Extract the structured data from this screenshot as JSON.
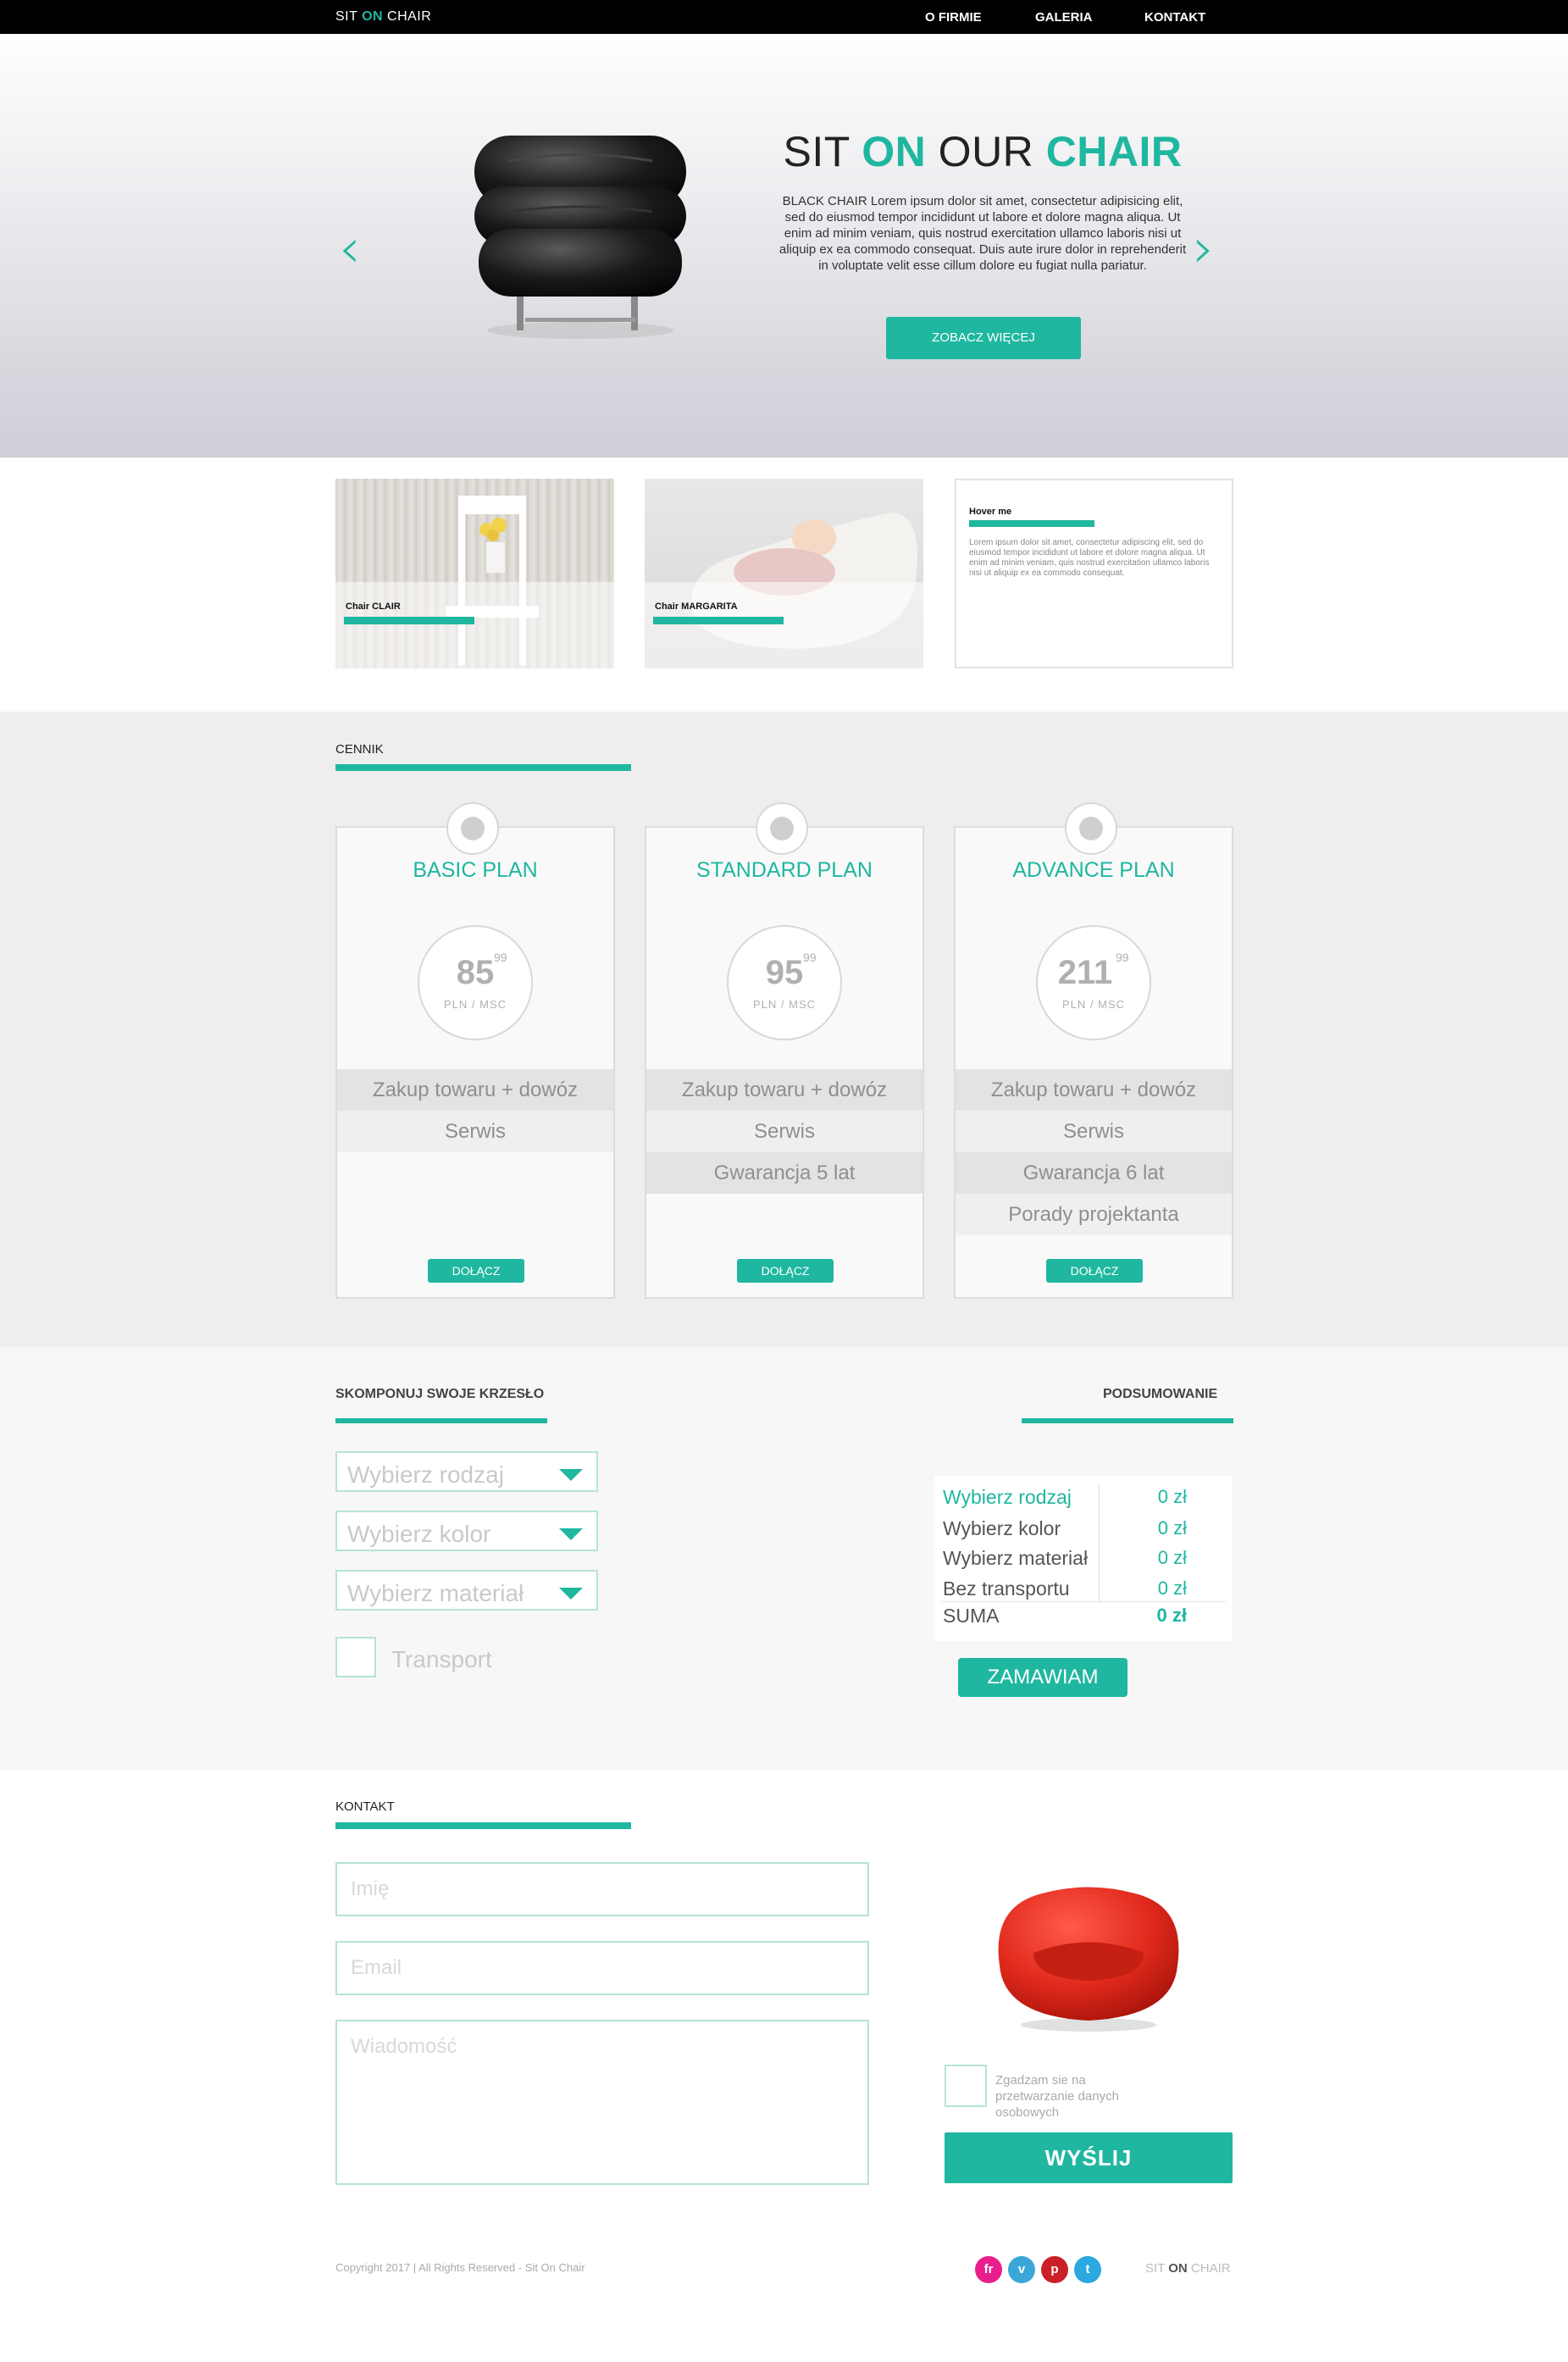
{
  "brand": {
    "prefix": "SIT",
    "highlight": "ON",
    "suffix": "CHAIR"
  },
  "nav": {
    "items": [
      "O FIRMIE",
      "GALERIA",
      "KONTAKT"
    ]
  },
  "hero": {
    "title_1": "SIT",
    "title_2": "ON",
    "title_3": "OUR",
    "title_4": "CHAIR",
    "text": "BLACK CHAIR Lorem ipsum dolor sit amet, consectetur adipisicing elit, sed do eiusmod tempor incididunt ut labore et dolore magna aliqua. Ut enim ad minim veniam, quis nostrud exercitation ullamco laboris nisi ut aliquip ex ea commodo consequat. Duis aute irure dolor in reprehenderit in voluptate velit esse cillum dolore eu fugiat nulla pariatur.",
    "button": "ZOBACZ WIĘCEJ",
    "prev_icon": "chevron-left-icon",
    "next_icon": "chevron-right-icon"
  },
  "gallery": {
    "cards": [
      {
        "label": "Chair CLAIR"
      },
      {
        "label": "Chair MARGARITA"
      }
    ],
    "hover_card": {
      "title": "Hover me",
      "text": "Lorem ipsum dolor sit amet, consectetur adipiscing elit, sed do eiusmod tempor incididunt ut labore et dolore magna aliqua. Ut enim ad minim veniam, quis nostrud exercitation ullamco laboris nisi ut aliquip ex ea commodo consequat."
    }
  },
  "pricing": {
    "title": "CENNIK",
    "plans": [
      {
        "name": "BASIC PLAN",
        "price": "85",
        "cents": "99",
        "unit": "PLN / MSC",
        "features": [
          "Zakup towaru + dowóz",
          "Serwis"
        ],
        "button": "DOŁĄCZ"
      },
      {
        "name": "STANDARD PLAN",
        "price": "95",
        "cents": "99",
        "unit": "PLN / MSC",
        "features": [
          "Zakup towaru + dowóz",
          "Serwis",
          "Gwarancja 5 lat"
        ],
        "button": "DOŁĄCZ"
      },
      {
        "name": "ADVANCE PLAN",
        "price": "211",
        "cents": "99",
        "unit": "PLN / MSC",
        "features": [
          "Zakup towaru + dowóz",
          "Serwis",
          "Gwarancja 6 lat",
          "Porady projektanta"
        ],
        "button": "DOŁĄCZ"
      }
    ]
  },
  "configurator": {
    "title": "SKOMPONUJ SWOJE KRZESŁO",
    "selects": [
      "Wybierz rodzaj",
      "Wybierz kolor",
      "Wybierz materiał"
    ],
    "transport_label": "Transport",
    "summary_title": "PODSUMOWANIE",
    "summary_rows": [
      {
        "label": "Wybierz rodzaj",
        "value": "0 zł"
      },
      {
        "label": "Wybierz kolor",
        "value": "0 zł"
      },
      {
        "label": "Wybierz materiał",
        "value": "0 zł"
      },
      {
        "label": "Bez transportu",
        "value": "0 zł"
      }
    ],
    "sum_label": "SUMA",
    "sum_value": "0 zł",
    "order_button": "ZAMAWIAM"
  },
  "contact": {
    "title": "KONTAKT",
    "name_placeholder": "Imię",
    "email_placeholder": "Email",
    "message_placeholder": "Wiadomość",
    "consent": "Zgadzam sie na przetwarzanie danych osobowych",
    "send_button": "WYŚLIJ"
  },
  "footer": {
    "copyright": "Copyright 2017 | All Rights Reserved - Sit On Chair",
    "social": [
      {
        "icon": "fr",
        "color": "#e91e8c"
      },
      {
        "icon": "v",
        "color": "#3aa7d8"
      },
      {
        "icon": "p",
        "color": "#cb2027"
      },
      {
        "icon": "t",
        "color": "#2aa9e0"
      }
    ]
  },
  "colors": {
    "accent": "#1fb7a0",
    "nav": "#000000"
  }
}
